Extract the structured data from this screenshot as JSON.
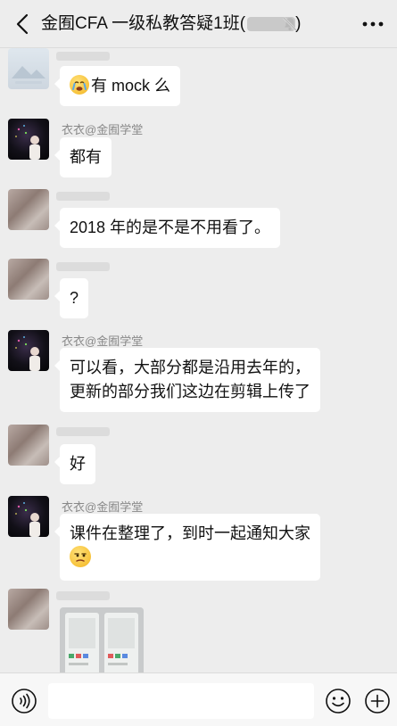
{
  "header": {
    "title": "金囿CFA 一级私教答疑1班",
    "title_paren_open": "(",
    "title_paren_close": ")",
    "back_icon": "chevron-left-icon",
    "mute_icon": "bell-muted-icon",
    "more_icon": "more-dots-icon"
  },
  "messages": [
    {
      "sender": "",
      "text": "有 mock 么",
      "emoji_before": "crying-face-emoji"
    },
    {
      "sender": "衣衣@金囿学堂",
      "text": "都有"
    },
    {
      "sender": "",
      "text": "2018 年的是不是不用看了。"
    },
    {
      "sender": "",
      "text": "?"
    },
    {
      "sender": "衣衣@金囿学堂",
      "line1": "可以看，大部分都是沿用去年的，",
      "line2": "更新的部分我们这边在剪辑上传了"
    },
    {
      "sender": "",
      "text": "好"
    },
    {
      "sender": "衣衣@金囿学堂",
      "line1": "课件在整理了，到时一起通知大家",
      "emoji_after": "smirk-face-emoji"
    },
    {
      "sender": "",
      "type": "image"
    }
  ],
  "input": {
    "value": "",
    "placeholder": ""
  },
  "toolbar": {
    "voice_icon": "voice-icon",
    "emoji_icon": "emoji-icon",
    "plus_icon": "plus-icon"
  },
  "colors": {
    "background": "#ededed",
    "bubble": "#ffffff",
    "sender_name": "#888888"
  }
}
